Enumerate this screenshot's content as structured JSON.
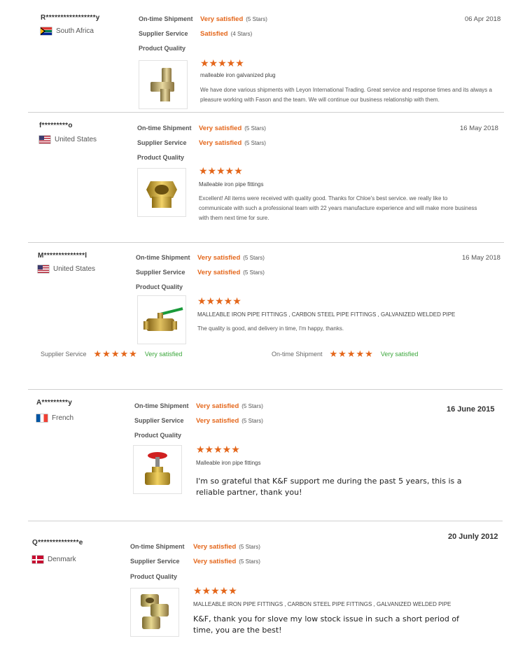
{
  "labels": {
    "ontime": "On-time Shipment",
    "supplier": "Supplier Service",
    "quality": "Product Quality",
    "stars5": "(5 Stars)",
    "stars4": "(4 Stars)"
  },
  "star_glyphs": "★★★★★",
  "colors": {
    "accent": "#e4661a",
    "green": "#3aa63a",
    "divider": "#cfcfcf"
  },
  "reviews": [
    {
      "buyer": "R*****************y",
      "country": "South Africa",
      "flag": "south-africa-flag-icon",
      "ontime": "Very satisfied",
      "supplier": "Satisfied",
      "date": "06 Apr 2018",
      "product": "malleable iron galvanized plug",
      "product_icon": "galvanized-plug-icon",
      "comment": "We have done various shipments with Leyon International Trading. Great service and response times and its always a pleasure working with Fason and the team. We will continue our business relationship with them."
    },
    {
      "buyer": "f*********o",
      "country": "United States",
      "flag": "us-flag-icon",
      "ontime": "Very satisfied",
      "supplier": "Very satisfied",
      "date": "16 May 2018",
      "product": "Malleable iron pipe fittings",
      "product_icon": "brass-nipple-icon",
      "comment": "Excellent! All items were received with quality good. Thanks for Chloe's best service. we really like to communicate with such a professional team with 22 years manufacture experience and will make more business with them next time for sure."
    },
    {
      "buyer": "M**************l",
      "country": "United States",
      "flag": "us-flag-icon",
      "ontime": "Very satisfied",
      "supplier": "Very satisfied",
      "date": "16 May 2018",
      "product": "MALLEABLE IRON PIPE FITTINGS , CARBON STEEL PIPE FITTINGS , GALVANIZED WELDED PIPE",
      "product_icon": "ball-valve-icon",
      "comment": "The quality is good, and delivery in time, I'm happy, thanks.",
      "summary": {
        "supplier_label": "Supplier Service",
        "supplier_value": "Very satisfied",
        "ontime_label": "On-time Shipment",
        "ontime_value": "Very satisfied"
      }
    },
    {
      "buyer": "A*********y",
      "country": "French",
      "flag": "france-flag-icon",
      "ontime": "Very satisfied",
      "supplier": "Very satisfied",
      "date": "16 June 2015",
      "product": "Malleable iron pipe fittings",
      "product_icon": "gate-valve-icon",
      "comment": "I'm so grateful that K&F support me during the past 5 years, this is a reliable partner, thank you!"
    },
    {
      "buyer": "Q**************e",
      "country": "Denmark",
      "flag": "denmark-flag-icon",
      "ontime": "Very satisfied",
      "supplier": "Very satisfied",
      "date": "20 Junly 2012",
      "product": "MALLEABLE IRON PIPE FITTINGS , CARBON STEEL PIPE FITTINGS , GALVANIZED WELDED PIPE",
      "product_icon": "brass-fittings-icon",
      "comment": "K&F, thank you for slove my low stock issue in such a short period of time,    you are the best!"
    }
  ]
}
